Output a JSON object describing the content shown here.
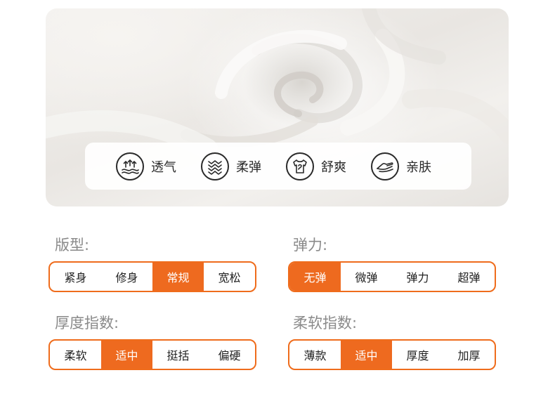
{
  "features": [
    {
      "label": "透气",
      "icon": "breathable-arrows-icon"
    },
    {
      "label": "柔弹",
      "icon": "elastic-waves-icon"
    },
    {
      "label": "舒爽",
      "icon": "shirt-icon"
    },
    {
      "label": "亲肤",
      "icon": "hand-touch-icon"
    }
  ],
  "colors": {
    "accent": "#ee6a1f",
    "title_gray": "#8a8a8a"
  },
  "specs": [
    {
      "title": "版型:",
      "options": [
        "紧身",
        "修身",
        "常规",
        "宽松"
      ],
      "selected": "常规"
    },
    {
      "title": "弹力:",
      "options": [
        "无弹",
        "微弹",
        "弹力",
        "超弹"
      ],
      "selected": "无弹"
    },
    {
      "title": "厚度指数:",
      "options": [
        "柔软",
        "适中",
        "挺括",
        "偏硬"
      ],
      "selected": "适中"
    },
    {
      "title": "柔软指数:",
      "options": [
        "薄款",
        "适中",
        "厚度",
        "加厚"
      ],
      "selected": "适中"
    }
  ]
}
